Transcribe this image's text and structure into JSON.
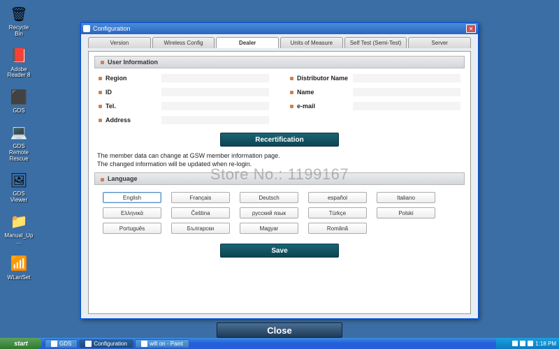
{
  "desktop": {
    "icons": [
      {
        "symbol": "🗑",
        "label": "Recycle Bin"
      },
      {
        "symbol": "📕",
        "label": "Adobe Reader 8"
      },
      {
        "symbol": "⬛",
        "label": "GDS"
      },
      {
        "symbol": "💻",
        "label": "GDS Remote Rescue"
      },
      {
        "symbol": "🖼",
        "label": "GDS Viewer"
      },
      {
        "symbol": "📁",
        "label": "Manual_Up..."
      },
      {
        "symbol": "📶",
        "label": "WLanSet"
      }
    ]
  },
  "window": {
    "title": "Configuration",
    "tabs": [
      "Version",
      "Wireless Config",
      "Dealer",
      "Units of Measure",
      "Self Test (Semi-Test)",
      "Server"
    ],
    "active_tab": "Dealer",
    "user_info": {
      "header": "User Information",
      "left_fields": [
        "Region",
        "ID",
        "Tel.",
        "Address"
      ],
      "right_fields": [
        "Distributor Name",
        "Name",
        "e-mail"
      ]
    },
    "recert_button": "Recertification",
    "info_text_1": "The member data can change at GSW member information page.",
    "info_text_2": "The changed information will be updated when re-login.",
    "language": {
      "header": "Language",
      "rows": [
        [
          "English",
          "Français",
          "Deutsch",
          "español",
          "Italiano"
        ],
        [
          "Ελληνικά",
          "Čeština",
          "русский язык",
          "Türkçe",
          "Polski"
        ],
        [
          "Português",
          "Български",
          "Magyar",
          "Română"
        ]
      ],
      "selected": "English"
    },
    "save_button": "Save",
    "close_button": "Close"
  },
  "taskbar": {
    "start": "start",
    "buttons": [
      "GDS",
      "Configuration",
      "wifi on - Paint"
    ],
    "active": "Configuration",
    "time": "1:18 PM"
  },
  "watermark": "Store No.: 1199167"
}
